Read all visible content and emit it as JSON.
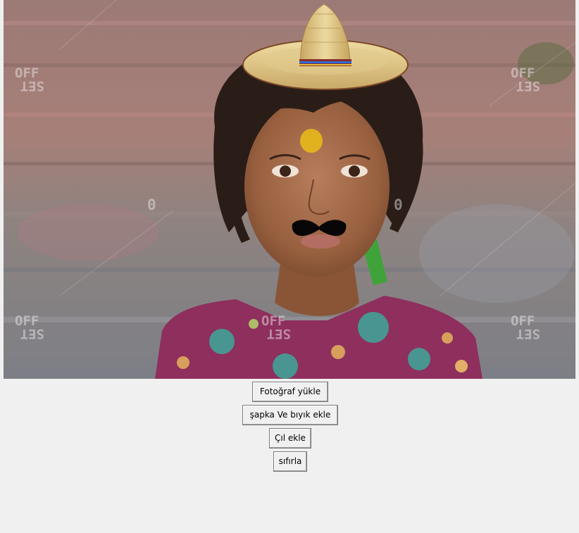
{
  "photo": {
    "description_icon": "photo-canvas",
    "watermarks": {
      "top_left_word": "OFF",
      "top_left_word2": "SET",
      "top_right_word": "OFF",
      "top_right_word2": "SET",
      "mid_left": "0",
      "mid_right": "0",
      "bottom_left_word": "OFF",
      "bottom_left_word2": "SET",
      "bottom_mid_word": "OFF",
      "bottom_mid_word2": "SET",
      "bottom_right_word": "OFF",
      "bottom_right_word2": "SET"
    },
    "overlays": [
      "sombrero-icon",
      "mustache-icon"
    ]
  },
  "buttons": {
    "upload_label": "Fotoğraf yükle",
    "hat_mustache_label": "şapka Ve bıyık ekle",
    "freckle_label": "Çıl ekle",
    "reset_label": "sıfırla"
  }
}
